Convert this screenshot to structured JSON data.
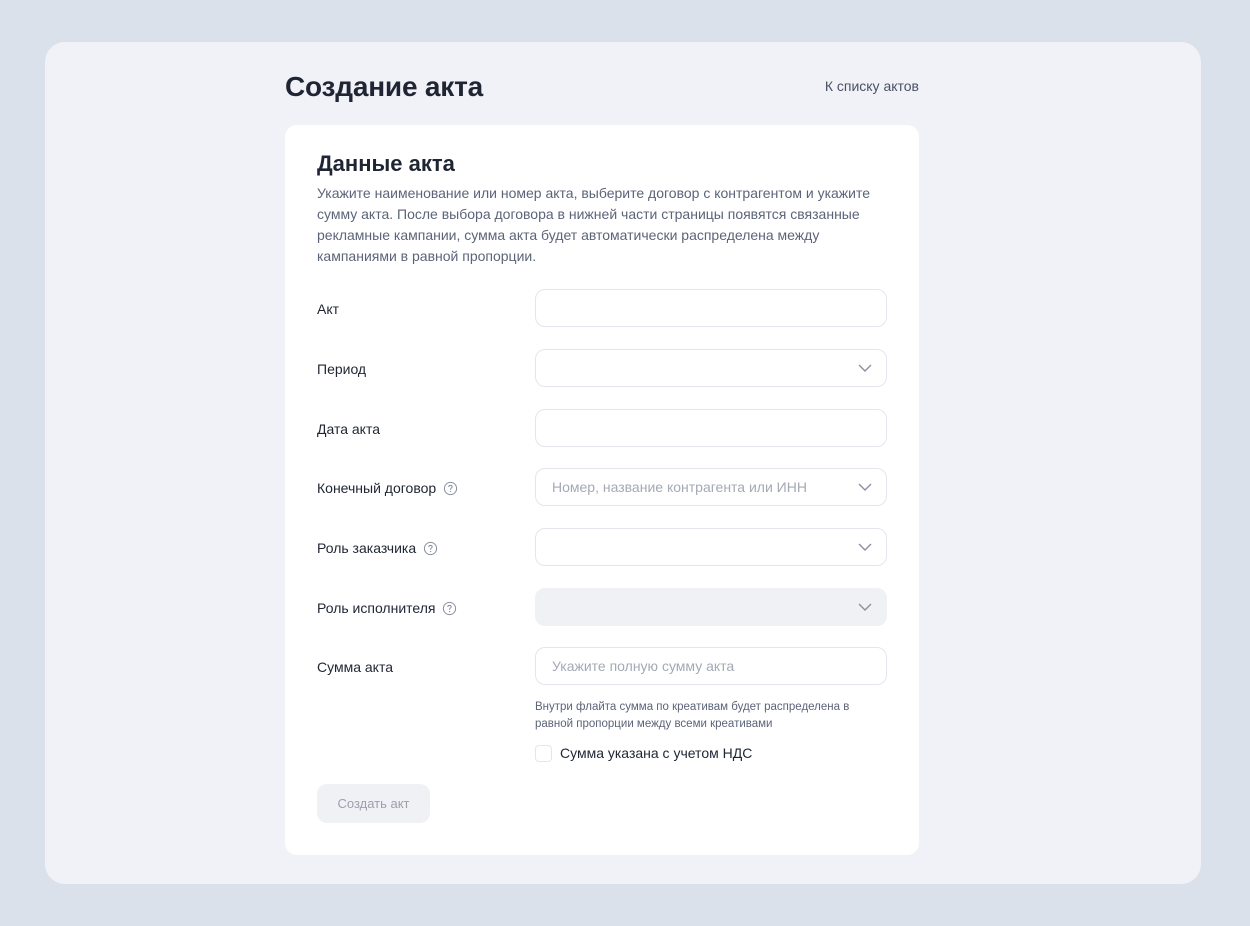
{
  "page": {
    "title": "Создание акта",
    "back_link": "К списку актов"
  },
  "card": {
    "title": "Данные акта",
    "description": "Укажите наименование или номер акта, выберите договор с контрагентом и укажите сумму акта. После выбора договора в нижней части страницы появятся связанные рекламные кампании, сумма акта будет автоматически распределена между кампаниями в равной пропорции."
  },
  "fields": {
    "act": {
      "label": "Акт",
      "value": ""
    },
    "period": {
      "label": "Период",
      "value": ""
    },
    "act_date": {
      "label": "Дата акта",
      "value": ""
    },
    "final_contract": {
      "label": "Конечный договор",
      "placeholder": "Номер, название контрагента или ИНН"
    },
    "customer_role": {
      "label": "Роль заказчика",
      "value": ""
    },
    "executor_role": {
      "label": "Роль исполнителя",
      "value": ""
    },
    "amount": {
      "label": "Сумма акта",
      "placeholder": "Укажите полную сумму акта"
    }
  },
  "amount_hint": "Внутри флайта сумма по креативам будет распределена в равной пропорции между всеми креативами",
  "vat_checkbox": {
    "label": "Сумма указана с учетом НДС",
    "checked": false
  },
  "submit_label": "Создать акт",
  "icons": {
    "help": "question-circle-icon",
    "chevron": "chevron-down-icon"
  },
  "colors": {
    "background": "#dbe1eb",
    "panel": "#f0f2f7",
    "card": "#ffffff",
    "text_primary": "#1f2533",
    "text_secondary": "#5c6478",
    "placeholder": "#a4a9b6",
    "disabled_fill": "#eff1f5"
  }
}
